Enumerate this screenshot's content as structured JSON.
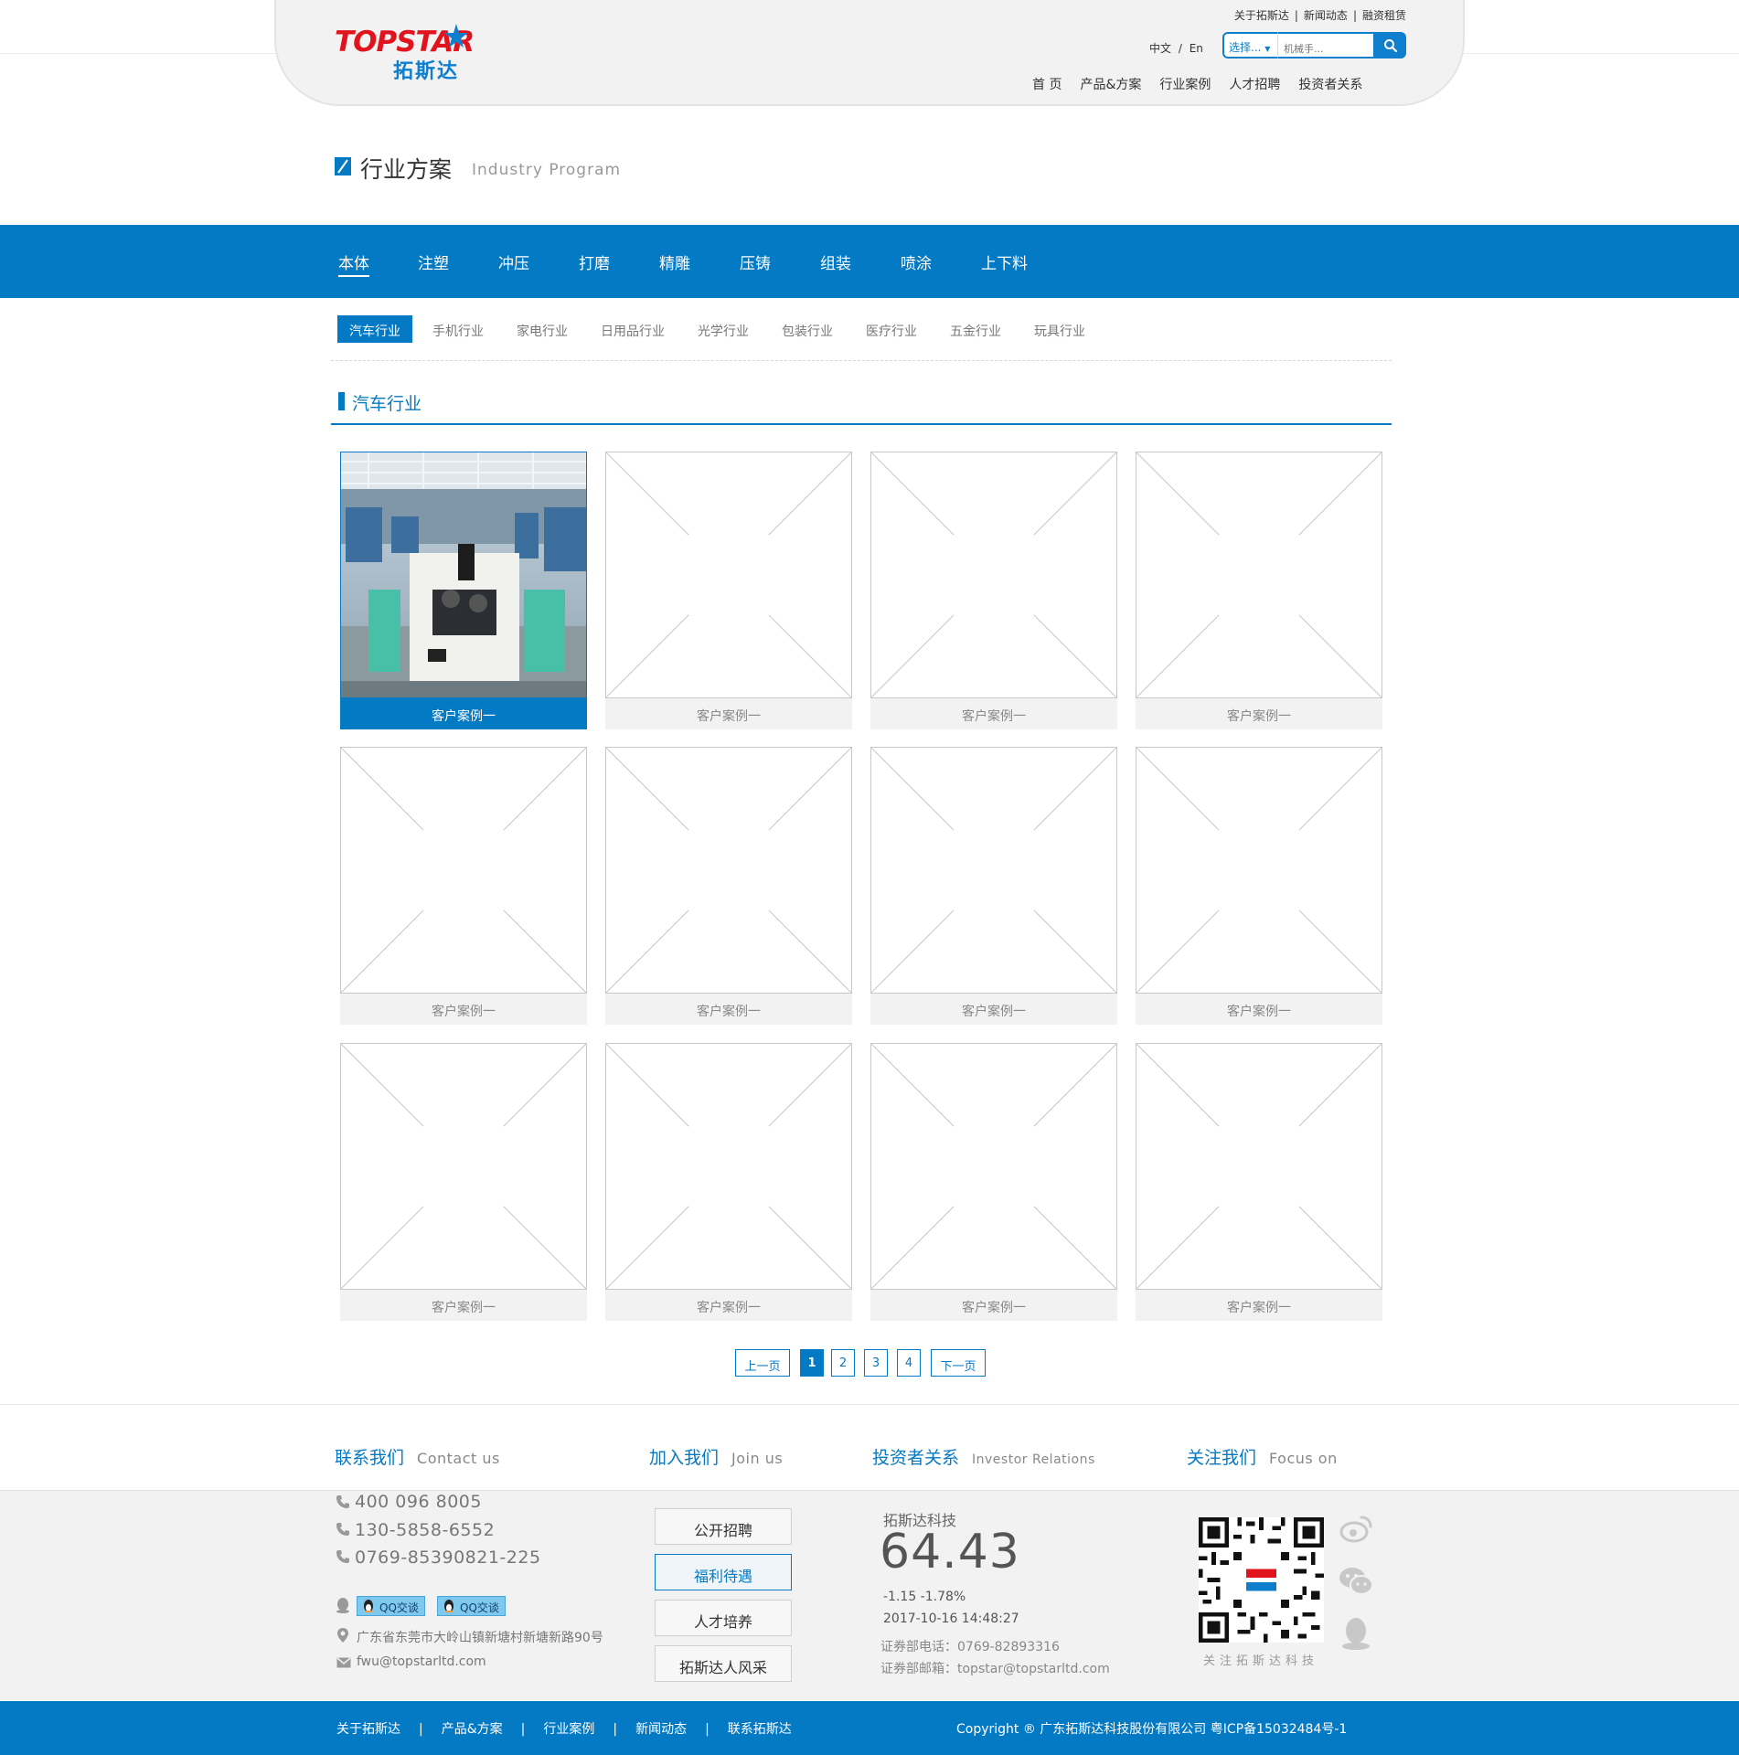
{
  "header": {
    "logo_en": "TOPSTAR",
    "logo_cn": "拓斯达",
    "util_links": [
      "关于拓斯达",
      "新闻动态",
      "融资租赁"
    ],
    "lang_cn": "中文",
    "lang_sep": "/",
    "lang_en": "En",
    "search_select": "选择...",
    "search_placeholder": "机械手...",
    "nav": [
      "首 页",
      "产品&方案",
      "行业案例",
      "人才招聘",
      "投资者关系"
    ]
  },
  "page_title": {
    "cn": "行业方案",
    "en": "Industry Program"
  },
  "categories": [
    "本体",
    "注塑",
    "冲压",
    "打磨",
    "精雕",
    "压铸",
    "组装",
    "喷涂",
    "上下料"
  ],
  "sub_tabs": [
    "汽车行业",
    "手机行业",
    "家电行业",
    "日用品行业",
    "光学行业",
    "包装行业",
    "医疗行业",
    "五金行业",
    "玩具行业"
  ],
  "section_title": "汽车行业",
  "cards": [
    "客户案例一",
    "客户案例一",
    "客户案例一",
    "客户案例一",
    "客户案例一",
    "客户案例一",
    "客户案例一",
    "客户案例一",
    "客户案例一",
    "客户案例一",
    "客户案例一",
    "客户案例一"
  ],
  "pagination": {
    "prev": "上一页",
    "pages": [
      "1",
      "2",
      "3",
      "4"
    ],
    "next": "下一页"
  },
  "footer": {
    "contact": {
      "title": "联系我们",
      "title_en": "Contact us",
      "phone1": "400 096 8005",
      "phone2": "130-5858-6552",
      "phone3": "0769-85390821-225",
      "qq1": "QQ交谈",
      "qq2": "QQ交谈",
      "address": "广东省东莞市大岭山镇新塘村新塘新路90号",
      "email": "fwu@topstarltd.com"
    },
    "join": {
      "title": "加入我们",
      "title_en": "Join us",
      "buttons": [
        "公开招聘",
        "福利待遇",
        "人才培养",
        "拓斯达人风采"
      ]
    },
    "investor": {
      "title": "投资者关系",
      "title_en": "Investor Relations",
      "stock_name": "拓斯达科技",
      "price": "64.43",
      "change": "-1.15  -1.78%",
      "time": "2017-10-16 14:48:27",
      "phone": "证券部电话：0769-82893316",
      "email": "证券部邮箱：topstar@topstarltd.com"
    },
    "follow": {
      "title": "关注我们",
      "title_en": "Focus on",
      "qr_label": "关注拓斯达科技"
    },
    "bottom_links": [
      "关于拓斯达",
      "产品&方案",
      "行业案例",
      "新闻动态",
      "联系拓斯达"
    ],
    "copyright": "Copyright ® 广东拓斯达科技股份有限公司   粤ICP备15032484号-1"
  },
  "colors": {
    "brand_blue": "#0479c4",
    "logo_red": "#e1141d"
  }
}
